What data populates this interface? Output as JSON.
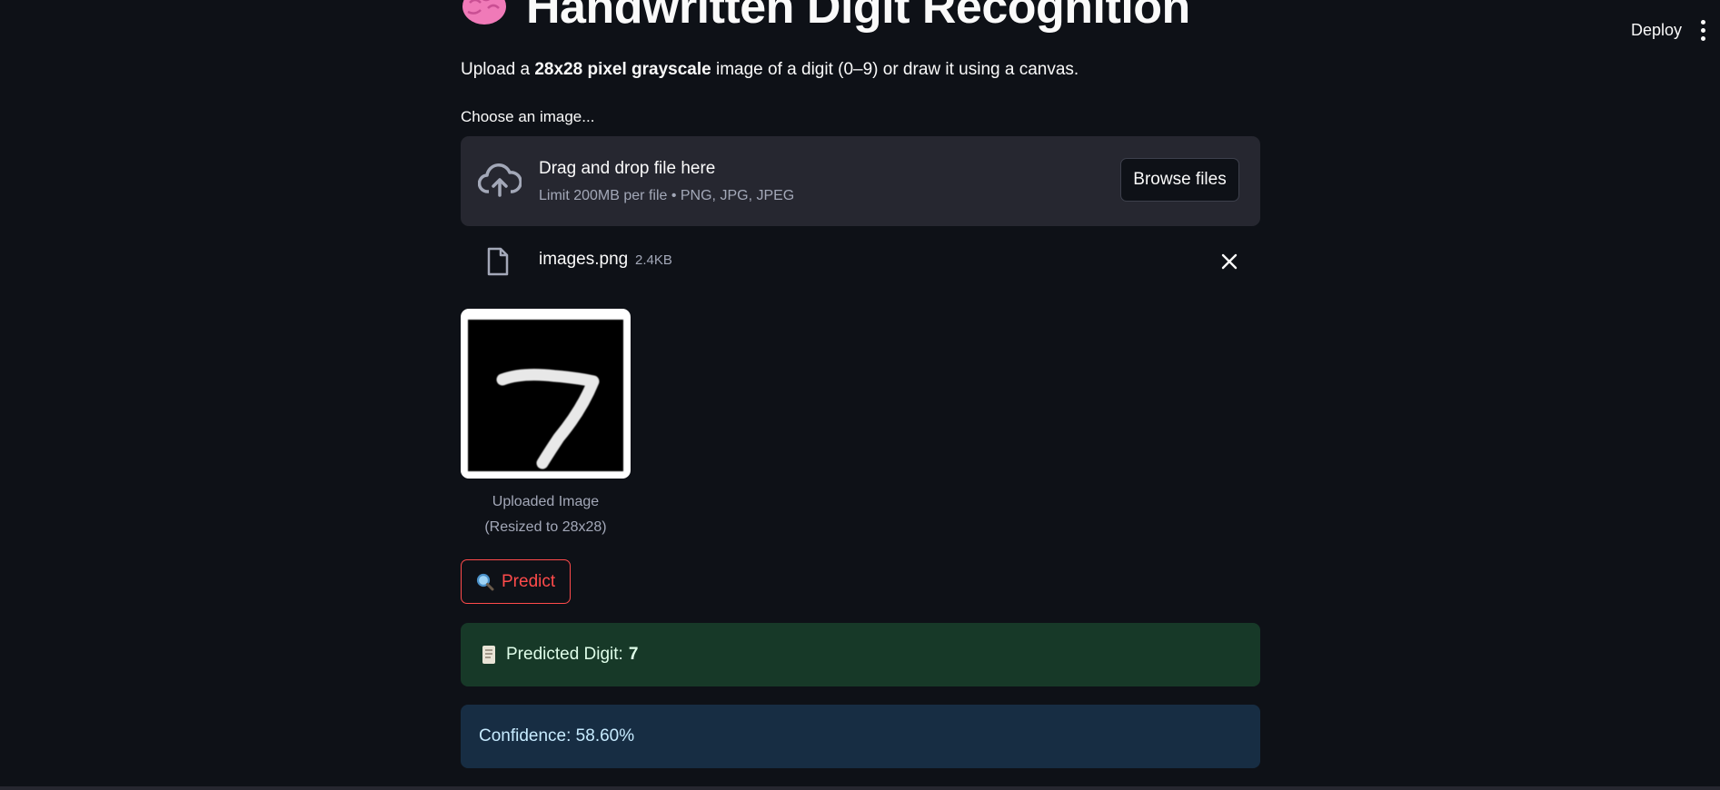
{
  "header": {
    "deploy_label": "Deploy",
    "menu_icon": "kebab-menu-icon"
  },
  "title": {
    "icon": "brain-icon",
    "text": "Handwritten Digit Recognition"
  },
  "subtitle": {
    "prefix": "Upload a ",
    "bold": "28x28 pixel grayscale",
    "suffix": " image of a digit (0–9) or draw it using a canvas."
  },
  "uploader": {
    "label": "Choose an image...",
    "drop_text": "Drag and drop file here",
    "limit_text": "Limit 200MB per file • PNG, JPG, JPEG",
    "browse_label": "Browse files",
    "icon": "cloud-upload-icon"
  },
  "uploaded_file": {
    "icon": "file-icon",
    "name": "images.png",
    "size": "2.4KB",
    "remove_icon": "close-icon"
  },
  "image": {
    "caption_line1": "Uploaded Image",
    "caption_line2": "(Resized to 28x28)"
  },
  "predict": {
    "icon": "magnifier-icon",
    "label": "Predict"
  },
  "result": {
    "icon": "scroll-icon",
    "label": "Predicted Digit: ",
    "digit": "7",
    "confidence": "Confidence: 58.60%"
  },
  "colors": {
    "background": "#0e1117",
    "accent": "#ff4b4b",
    "success_bg": "#173928",
    "info_bg": "#172d43"
  }
}
